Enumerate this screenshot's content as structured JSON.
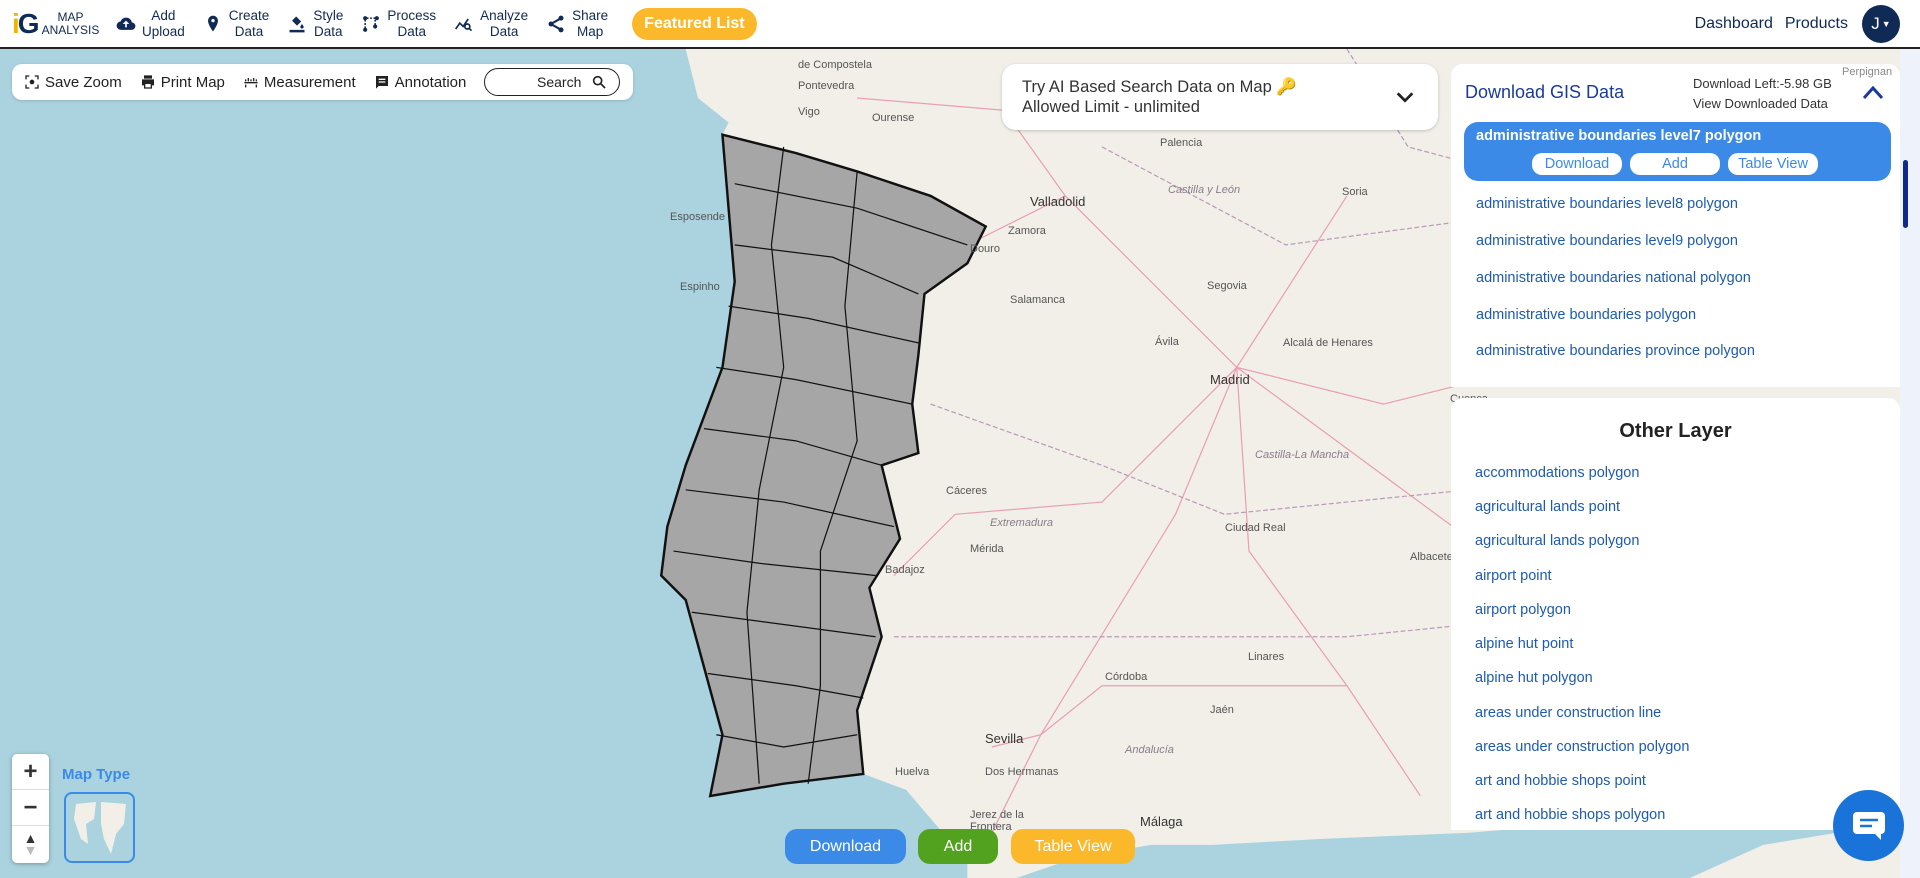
{
  "header": {
    "logo_text": "iG",
    "logo_line1": "MAP",
    "logo_line2": "ANALYSIS",
    "nav": [
      {
        "icon": "cloud-upload-icon",
        "line1": "Add",
        "line2": "Upload"
      },
      {
        "icon": "map-pin-icon",
        "line1": "Create",
        "line2": "Data"
      },
      {
        "icon": "paint-bucket-icon",
        "line1": "Style",
        "line2": "Data"
      },
      {
        "icon": "process-icon",
        "line1": "Process",
        "line2": "Data"
      },
      {
        "icon": "analyze-icon",
        "line1": "Analyze",
        "line2": "Data"
      },
      {
        "icon": "share-icon",
        "line1": "Share",
        "line2": "Map"
      }
    ],
    "featured_label": "Featured List",
    "dashboard_label": "Dashboard",
    "products_label": "Products",
    "avatar_initial": "J"
  },
  "toolbar": {
    "save_zoom": "Save Zoom",
    "print_map": "Print Map",
    "measurement": "Measurement",
    "annotation": "Annotation",
    "search_placeholder": "Search"
  },
  "ai_search": {
    "line1": "Try AI Based Search Data on Map",
    "line2": "Allowed Limit - unlimited"
  },
  "download_panel": {
    "title": "Download GIS Data",
    "download_left": "Download Left:-5.98 GB",
    "view_downloaded": "View Downloaded Data",
    "selected": {
      "name": "administrative boundaries level7 polygon",
      "download": "Download",
      "add": "Add",
      "table_view": "Table View"
    },
    "items": [
      "administrative boundaries level8 polygon",
      "administrative boundaries level9 polygon",
      "administrative boundaries national polygon",
      "administrative boundaries polygon",
      "administrative boundaries province polygon"
    ]
  },
  "other_layer": {
    "title": "Other Layer",
    "items": [
      "accommodations polygon",
      "agricultural lands point",
      "agricultural lands polygon",
      "airport point",
      "airport polygon",
      "alpine hut point",
      "alpine hut polygon",
      "areas under construction line",
      "areas under construction polygon",
      "art and hobbie shops point",
      "art and hobbie shops polygon"
    ]
  },
  "map": {
    "map_type_label": "Map Type",
    "zoom_in": "+",
    "zoom_out": "−",
    "colors": {
      "water": "#aad3df",
      "land": "#f2efe9",
      "selection": "#a6a6a6"
    },
    "labels": [
      "de Compostela",
      "Pontevedra",
      "Vigo",
      "Ourense",
      "Esposende",
      "Espinho",
      "Palencia",
      "Valladolid",
      "Soria",
      "Zamora",
      "Douro",
      "Salamanca",
      "Segovia",
      "Ávila",
      "Madrid",
      "Alcalá de Henares",
      "Cuenca",
      "Castilla y León",
      "Cáceres",
      "Extremadura",
      "Mérida",
      "Ciudad Real",
      "Castilla-La Mancha",
      "Badajoz",
      "Córdoba",
      "Jaén",
      "Linares",
      "Albacete",
      "Sevilla",
      "Andalucía",
      "Huelva",
      "Dos Hermanas",
      "Jerez de la Frontera",
      "Málaga",
      "Perpignan"
    ]
  },
  "bottom_buttons": {
    "download": "Download",
    "add": "Add",
    "table_view": "Table View"
  }
}
